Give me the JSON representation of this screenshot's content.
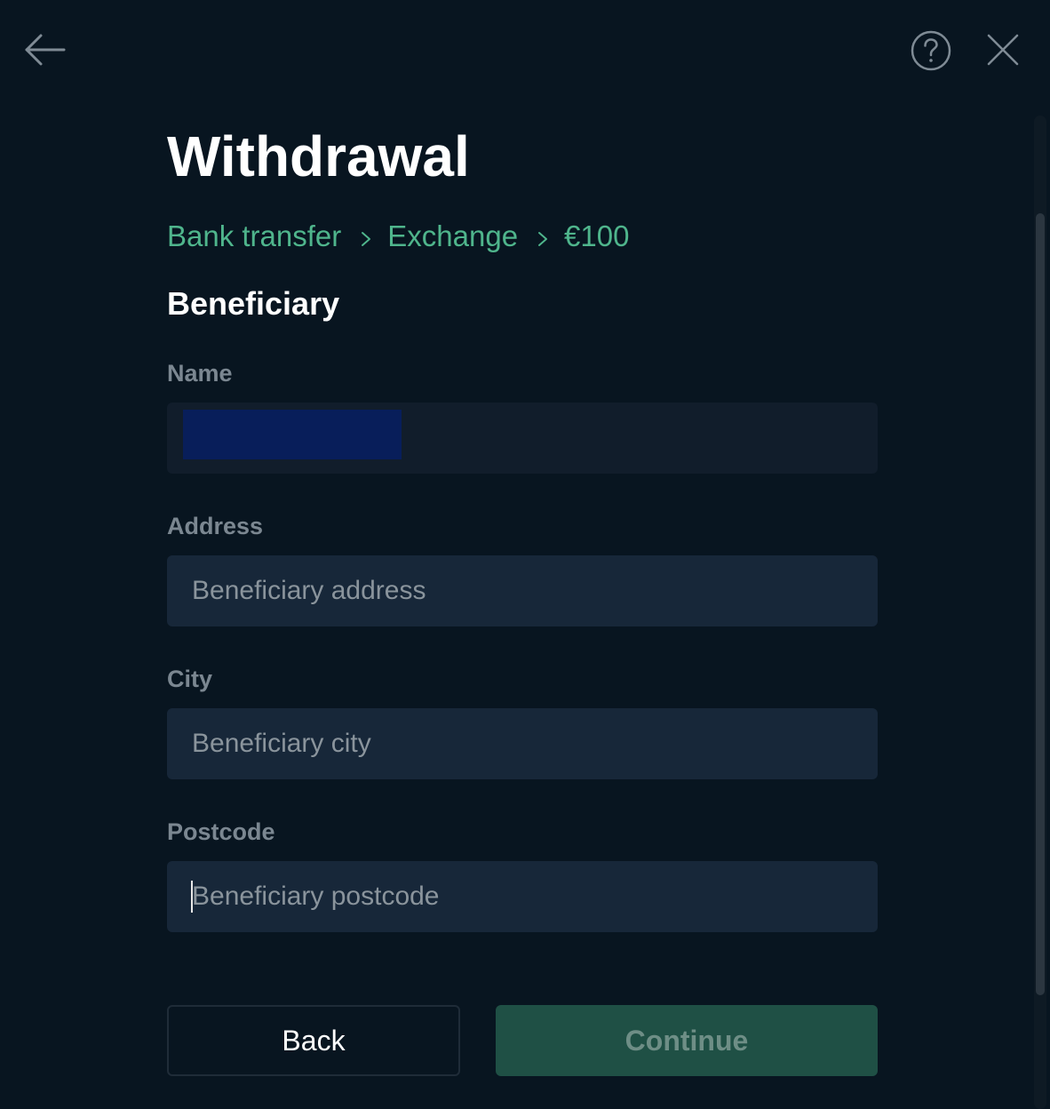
{
  "header": {
    "back_icon": "arrow-left-icon",
    "help_icon": "question-circle-icon",
    "close_icon": "close-x-icon"
  },
  "page": {
    "title": "Withdrawal",
    "breadcrumb": [
      "Bank transfer",
      "Exchange",
      "€100"
    ],
    "section_title": "Beneficiary"
  },
  "form": {
    "name": {
      "label": "Name",
      "value": "",
      "placeholder": ""
    },
    "address": {
      "label": "Address",
      "value": "",
      "placeholder": "Beneficiary address"
    },
    "city": {
      "label": "City",
      "value": "",
      "placeholder": "Beneficiary city"
    },
    "postcode": {
      "label": "Postcode",
      "value": "",
      "placeholder": "Beneficiary postcode"
    }
  },
  "actions": {
    "back_label": "Back",
    "continue_label": "Continue"
  },
  "colors": {
    "background": "#081520",
    "accent": "#4fb58c",
    "input_bg": "#172739",
    "continue_bg": "#1f5045"
  }
}
